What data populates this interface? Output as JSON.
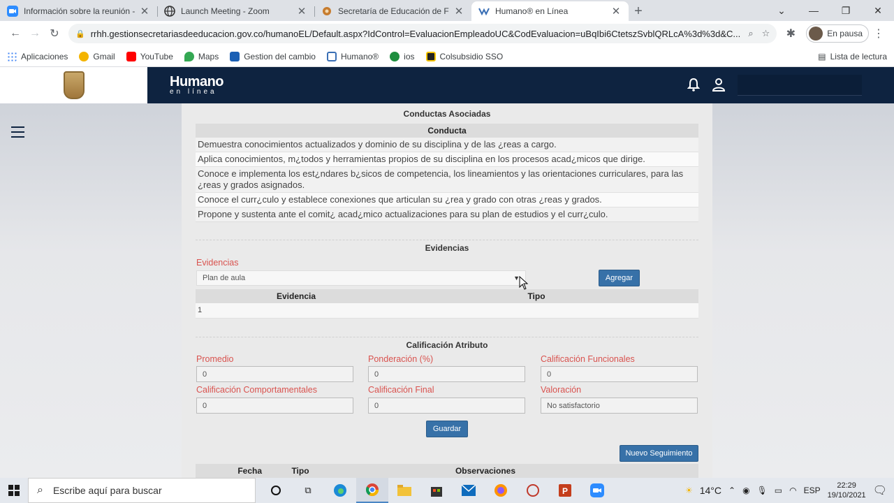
{
  "browser": {
    "tabs": [
      {
        "title": "Información sobre la reunión - Z",
        "icon": "zoom-icon",
        "active": false
      },
      {
        "title": "Launch Meeting - Zoom",
        "icon": "globe-icon",
        "active": false
      },
      {
        "title": "Secretaría de Educación de Facat",
        "icon": "gear-icon",
        "active": false
      },
      {
        "title": "Humano® en Línea",
        "icon": "humano-icon",
        "active": true
      }
    ],
    "url": "rrhh.gestionsecretariasdeeducacion.gov.co/humanoEL/Default.aspx?IdControl=EvaluacionEmpleadoUC&CodEvaluacion=uBqIbi6CtetszSvblQRLcA%3d%3d&C...",
    "profile_label": "En pausa",
    "bookmarks": [
      "Aplicaciones",
      "Gmail",
      "YouTube",
      "Maps",
      "Gestion del cambio",
      "Humano®",
      "ios",
      "Colsubsidio SSO"
    ],
    "reading_list": "Lista de lectura"
  },
  "app": {
    "brand_line1": "Humano",
    "brand_line2": "en línea"
  },
  "conductas": {
    "section_title": "Conductas Asociadas",
    "column_header": "Conducta",
    "rows": [
      "Demuestra conocimientos actualizados y dominio de su disciplina y de las ¿reas a cargo.",
      "Aplica conocimientos, m¿todos y herramientas propios de su disciplina en los procesos acad¿micos que dirige.",
      "Conoce e implementa los est¿ndares b¿sicos de competencia, los lineamientos y las orientaciones curriculares, para las ¿reas y grados asignados.",
      "Conoce el curr¿culo y establece conexiones que articulan su ¿rea y grado con otras ¿reas y grados.",
      "Propone y sustenta ante el comit¿ acad¿mico actualizaciones para su plan de estudios y el curr¿culo."
    ]
  },
  "evidencias": {
    "section_title": "Evidencias",
    "label": "Evidencias",
    "selected": "Plan de aula",
    "add_button": "Agregar",
    "col_evidencia": "Evidencia",
    "col_tipo": "Tipo",
    "row_value": "1"
  },
  "calificacion": {
    "section_title": "Calificación Atributo",
    "promedio_label": "Promedio",
    "promedio_value": "0",
    "ponderacion_label": "Ponderación (%)",
    "ponderacion_value": "0",
    "funcionales_label": "Calificación Funcionales",
    "funcionales_value": "0",
    "comportamentales_label": "Calificación Comportamentales",
    "comportamentales_value": "0",
    "final_label": "Calificación Final",
    "final_value": "0",
    "valoracion_label": "Valoración",
    "valoracion_value": "No satisfactorio",
    "save_button": "Guardar"
  },
  "seguimiento": {
    "new_button": "Nuevo Seguimiento",
    "col_fecha": "Fecha",
    "col_tipo": "Tipo",
    "col_observaciones": "Observaciones"
  },
  "taskbar": {
    "search_placeholder": "Escribe aquí para buscar",
    "temperature": "14°C",
    "language": "ESP",
    "time": "22:29",
    "date": "19/10/2021"
  }
}
